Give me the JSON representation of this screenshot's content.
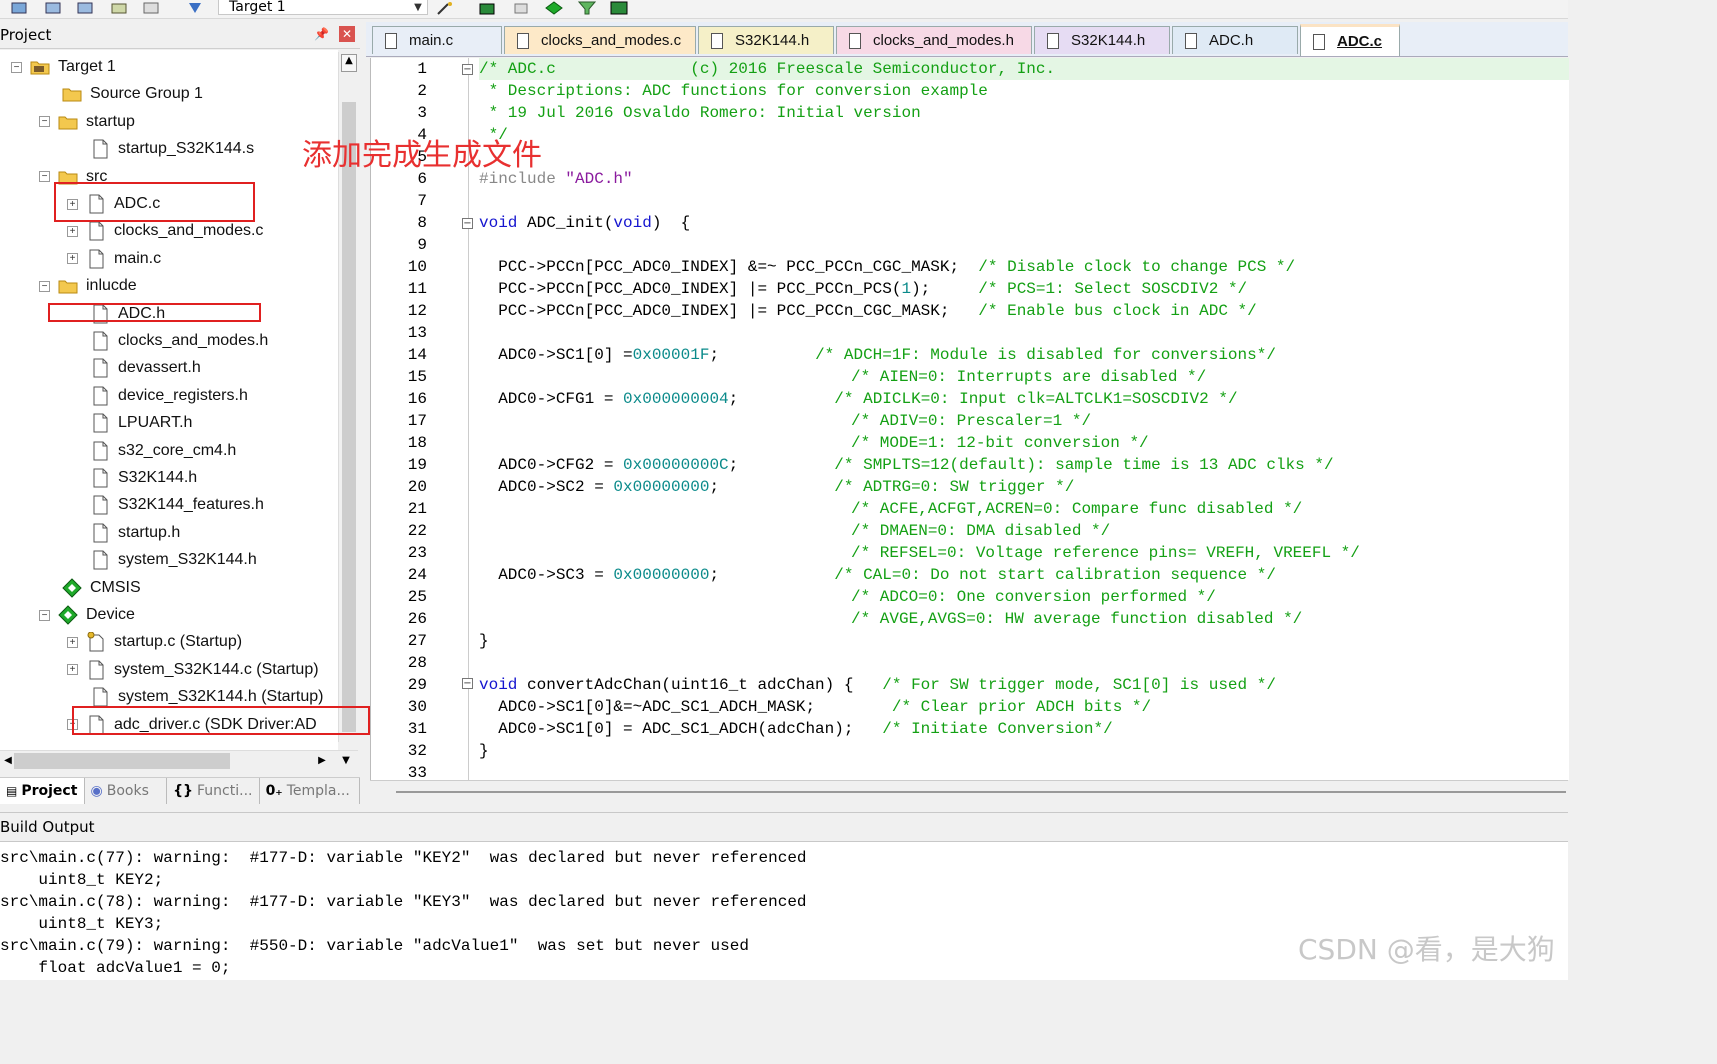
{
  "toolbar": {
    "target_label": "Target 1"
  },
  "project_panel": {
    "title": "Project",
    "tree": [
      {
        "label": "Target 1",
        "icon": "target-icon",
        "expanded": true
      },
      {
        "label": "Source Group 1",
        "icon": "folder-icon"
      },
      {
        "label": "startup",
        "icon": "folder-icon",
        "expanded": true
      },
      {
        "label": "startup_S32K144.s",
        "icon": "file-icon"
      },
      {
        "label": "src",
        "icon": "folder-icon",
        "expanded": true
      },
      {
        "label": "ADC.c",
        "icon": "file-icon",
        "expandable": true
      },
      {
        "label": "clocks_and_modes.c",
        "icon": "file-icon",
        "expandable": true
      },
      {
        "label": "main.c",
        "icon": "file-icon",
        "expandable": true
      },
      {
        "label": "inlucde",
        "icon": "folder-icon",
        "expanded": true
      },
      {
        "label": "ADC.h",
        "icon": "file-icon"
      },
      {
        "label": "clocks_and_modes.h",
        "icon": "file-icon"
      },
      {
        "label": "devassert.h",
        "icon": "file-icon"
      },
      {
        "label": "device_registers.h",
        "icon": "file-icon"
      },
      {
        "label": "LPUART.h",
        "icon": "file-icon"
      },
      {
        "label": "s32_core_cm4.h",
        "icon": "file-icon"
      },
      {
        "label": "S32K144.h",
        "icon": "file-icon"
      },
      {
        "label": "S32K144_features.h",
        "icon": "file-icon"
      },
      {
        "label": "startup.h",
        "icon": "file-icon"
      },
      {
        "label": "system_S32K144.h",
        "icon": "file-icon"
      },
      {
        "label": "CMSIS",
        "icon": "component-icon"
      },
      {
        "label": "Device",
        "icon": "component-icon",
        "expanded": true
      },
      {
        "label": "startup.c (Startup)",
        "icon": "key-file-icon",
        "expandable": true
      },
      {
        "label": "system_S32K144.c (Startup)",
        "icon": "file-icon",
        "expandable": true
      },
      {
        "label": "system_S32K144.h (Startup)",
        "icon": "file-icon"
      },
      {
        "label": "adc_driver.c (SDK Driver:AD",
        "icon": "file-icon",
        "expandable": true
      }
    ],
    "bottom_tabs": [
      "Project",
      "Books",
      "Functi...",
      "Templa..."
    ]
  },
  "annotation_text": "添加完成生成文件",
  "editor": {
    "tabs": [
      {
        "label": "main.c",
        "color": "#e8eef7"
      },
      {
        "label": "clocks_and_modes.c",
        "color": "#fde9c8"
      },
      {
        "label": "S32K144.h",
        "color": "#f5f0c8"
      },
      {
        "label": "clocks_and_modes.h",
        "color": "#f7d9e6"
      },
      {
        "label": "S32K144.h",
        "color": "#e6dcf3"
      },
      {
        "label": "ADC.h",
        "color": "#dfeaf5"
      },
      {
        "label": "ADC.c",
        "color": "#fbe3c4",
        "active": true
      }
    ],
    "line_numbers": [
      "1",
      "2",
      "3",
      "4",
      "5",
      "6",
      "7",
      "8",
      "9",
      "10",
      "11",
      "12",
      "13",
      "14",
      "15",
      "16",
      "17",
      "18",
      "19",
      "20",
      "21",
      "22",
      "23",
      "24",
      "25",
      "26",
      "27",
      "28",
      "29",
      "30",
      "31",
      "32",
      "33"
    ],
    "code": {
      "l1": "/* ADC.c              (c) 2016 Freescale Semiconductor, Inc.",
      "l2": " * Descriptions: ADC functions for conversion example",
      "l3": " * 19 Jul 2016 Osvaldo Romero: Initial version",
      "l4": " */",
      "l6a": "#include ",
      "l6b": "\"ADC.h\"",
      "l8a": "void",
      "l8b": " ADC_init(",
      "l8c": "void",
      "l8d": ")  {",
      "l10a": "  PCC->PCCn[PCC_ADC0_INDEX] &=~ PCC_PCCn_CGC_MASK;  ",
      "l10b": "/* Disable clock to change PCS */",
      "l11a": "  PCC->PCCn[PCC_ADC0_INDEX] |= PCC_PCCn_PCS(",
      "l11b": "1",
      "l11c": ");     ",
      "l11d": "/* PCS=1: Select SOSCDIV2 */",
      "l12a": "  PCC->PCCn[PCC_ADC0_INDEX] |= PCC_PCCn_CGC_MASK;   ",
      "l12b": "/* Enable bus clock in ADC */",
      "l14a": "  ADC0->SC1[0] =",
      "l14b": "0x00001F",
      "l14c": ";          ",
      "l14d": "/* ADCH=1F: Module is disabled for conversions*/",
      "l15": "/* AIEN=0: Interrupts are disabled */",
      "l16a": "  ADC0->CFG1 = ",
      "l16b": "0x000000004",
      "l16c": ";          ",
      "l16d": "/* ADICLK=0: Input clk=ALTCLK1=SOSCDIV2 */",
      "l17": "/* ADIV=0: Prescaler=1 */",
      "l18": "/* MODE=1: 12-bit conversion */",
      "l19a": "  ADC0->CFG2 = ",
      "l19b": "0x00000000C",
      "l19c": ";          ",
      "l19d": "/* SMPLTS=12(default): sample time is 13 ADC clks */",
      "l20a": "  ADC0->SC2 = ",
      "l20b": "0x00000000",
      "l20c": ";            ",
      "l20d": "/* ADTRG=0: SW trigger */",
      "l21": "/* ACFE,ACFGT,ACREN=0: Compare func disabled */",
      "l22": "/* DMAEN=0: DMA disabled */",
      "l23": "/* REFSEL=0: Voltage reference pins= VREFH, VREEFL */",
      "l24a": "  ADC0->SC3 = ",
      "l24b": "0x00000000",
      "l24c": ";            ",
      "l24d": "/* CAL=0: Do not start calibration sequence */",
      "l25": "/* ADCO=0: One conversion performed */",
      "l26": "/* AVGE,AVGS=0: HW average function disabled */",
      "l27": "}",
      "l29a": "void",
      "l29b": " convertAdcChan(uint16_t adcChan) {   ",
      "l29c": "/* For SW trigger mode, SC1[0] is used */",
      "l30a": "  ADC0->SC1[0]&=~ADC_SC1_ADCH_MASK;        ",
      "l30b": "/* Clear prior ADCH bits */",
      "l31a": "  ADC0->SC1[0] = ADC_SC1_ADCH(adcChan);   ",
      "l31b": "/* Initiate Conversion*/",
      "l32": "}"
    }
  },
  "build_output": {
    "title": "Build Output",
    "lines": [
      "src\\main.c(77): warning:  #177-D: variable \"KEY2\"  was declared but never referenced",
      "    uint8_t KEY2;",
      "src\\main.c(78): warning:  #177-D: variable \"KEY3\"  was declared but never referenced",
      "    uint8_t KEY3;",
      "src\\main.c(79): warning:  #550-D: variable \"adcValue1\"  was set but never used",
      "    float adcValue1 = 0;"
    ]
  },
  "watermark": "CSDN @看，是大狗"
}
